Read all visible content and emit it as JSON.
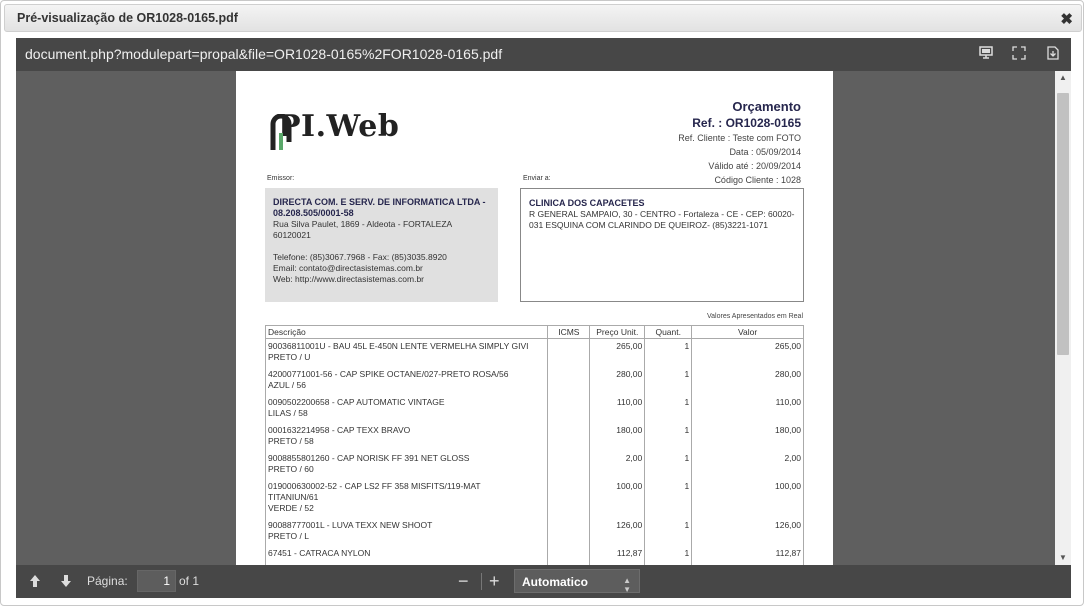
{
  "dialog": {
    "title": "Pré-visualização de OR1028-0165.pdf",
    "close_icon": "✖"
  },
  "viewer": {
    "file_title": "document.php?modulepart=propal&file=OR1028-0165%2FOR1028-0165.pdf",
    "page_label": "Página:",
    "page_value": "1",
    "page_of": "of 1",
    "zoom_out": "−",
    "zoom_in": "+",
    "zoom_value": "Automatico"
  },
  "document": {
    "logo_text": "PI.Web",
    "doc_type": "Orçamento",
    "ref": "Ref. : OR1028-0165",
    "ref_client": "Ref. Cliente : Teste com FOTO",
    "date": "Data : 05/09/2014",
    "valid_until": "Válido até : 20/09/2014",
    "client_code": "Código Cliente : 1028",
    "emissor_label": "Emissor:",
    "dest_label": "Enviar a:",
    "emissor": {
      "name": "DIRECTA COM. E SERV. DE INFORMATICA LTDA  - 08.208.505/0001-58",
      "address": "Rua Silva Paulet, 1869 - Aldeota -  FORTALEZA 60120021",
      "phone": "Telefone: (85)3067.7968 - Fax: (85)3035.8920",
      "email": "Email: contato@directasistemas.com.br",
      "web": "Web: http://www.directasistemas.com.br"
    },
    "recipient": {
      "name": "CLINICA DOS CAPACETES",
      "address": "R GENERAL SAMPAIO, 30 - CENTRO - Fortaleza - CE - CEP: 60020-031  ESQUINA COM CLARINDO DE QUEIROZ- (85)3221-1071"
    },
    "currency_note": "Valores Apresentados em Real",
    "columns": {
      "desc": "Descrição",
      "icms": "ICMS",
      "unit_price": "Preço Unit.",
      "qty": "Quant.",
      "value": "Valor"
    },
    "lines": [
      {
        "desc": "90036811001U - BAU 45L E-450N LENTE VERMELHA SIMPLY GIVI\nPRETO / U",
        "icms": "",
        "unit_price": "265,00",
        "qty": "1",
        "value": "265,00"
      },
      {
        "desc": "42000771001-56 - CAP SPIKE OCTANE/027-PRETO ROSA/56\nAZUL / 56",
        "icms": "",
        "unit_price": "280,00",
        "qty": "1",
        "value": "280,00"
      },
      {
        "desc": "0090502200658 - CAP AUTOMATIC VINTAGE\nLILAS / 58",
        "icms": "",
        "unit_price": "110,00",
        "qty": "1",
        "value": "110,00"
      },
      {
        "desc": "0001632214958 - CAP TEXX BRAVO\nPRETO / 58",
        "icms": "",
        "unit_price": "180,00",
        "qty": "1",
        "value": "180,00"
      },
      {
        "desc": "9008855801260 - CAP NORISK FF 391 NET GLOSS\nPRETO / 60",
        "icms": "",
        "unit_price": "2,00",
        "qty": "1",
        "value": "2,00"
      },
      {
        "desc": "019000630002-52 - CAP LS2 FF 358 MISFITS/119-MAT\nTITANIUN/61\nVERDE / 52",
        "icms": "",
        "unit_price": "100,00",
        "qty": "1",
        "value": "100,00"
      },
      {
        "desc": "90088777001L - LUVA TEXX NEW SHOOT\nPRETO / L",
        "icms": "",
        "unit_price": "126,00",
        "qty": "1",
        "value": "126,00"
      },
      {
        "desc": "67451 - CATRACA NYLON",
        "icms": "",
        "unit_price": "112,87",
        "qty": "1",
        "value": "112,87"
      }
    ]
  },
  "colors": {
    "toolbar_bg": "#474747",
    "viewer_bg": "#5f5f5f",
    "title_navy": "#26264d",
    "logo_green": "#5aa86a"
  }
}
